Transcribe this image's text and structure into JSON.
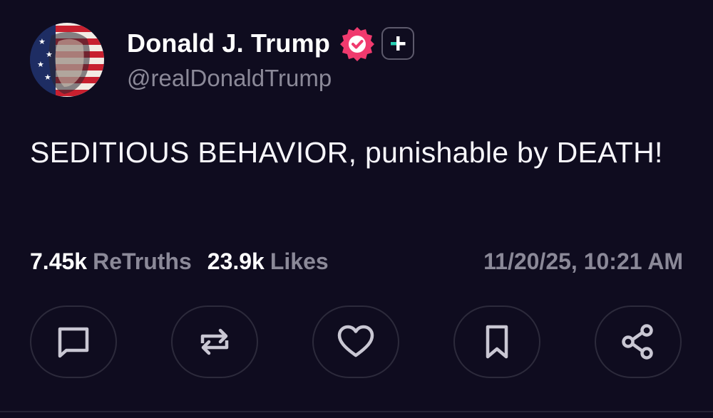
{
  "author": {
    "display_name": "Donald J. Trump",
    "handle": "@realDonaldTrump",
    "verified_badge_color": "#f03a6e",
    "plus_badge_accent": "#26d0b3",
    "avatar_icon": "flag-portrait-avatar"
  },
  "post": {
    "text": "SEDITIOUS BEHAVIOR, punishable by DEATH!"
  },
  "stats": {
    "retruths_value": "7.45k",
    "retruths_label": "ReTruths",
    "likes_value": "23.9k",
    "likes_label": "Likes",
    "timestamp": "11/20/25, 10:21 AM"
  },
  "actions": [
    {
      "name": "reply",
      "icon": "comment-icon"
    },
    {
      "name": "retruth",
      "icon": "repost-icon"
    },
    {
      "name": "like",
      "icon": "heart-icon"
    },
    {
      "name": "bookmark",
      "icon": "bookmark-icon"
    },
    {
      "name": "share",
      "icon": "share-icon"
    }
  ],
  "colors": {
    "background": "#0f0c1f",
    "text_primary": "#ffffff",
    "text_secondary": "#8b8998",
    "icon": "#c9c7d3",
    "button_border": "#2c2a3b"
  }
}
